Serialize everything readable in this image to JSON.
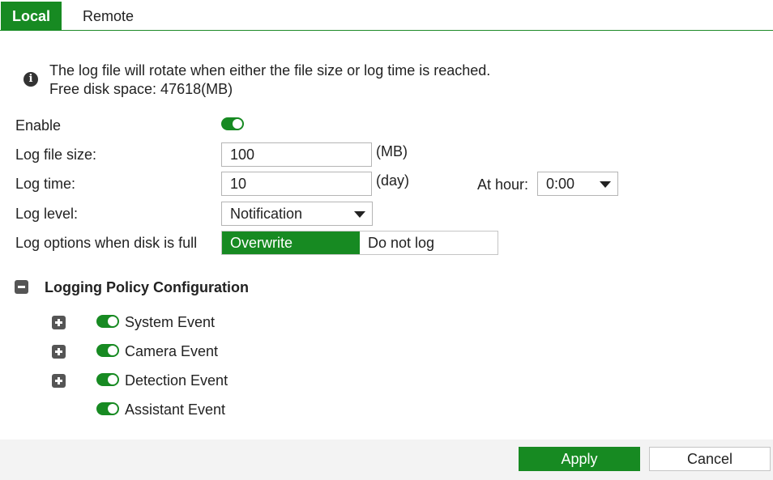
{
  "tabs": [
    {
      "label": "Local",
      "active": true
    },
    {
      "label": "Remote",
      "active": false
    }
  ],
  "info": {
    "icon": "info-icon",
    "line1": "The log file will rotate when either the file size or log time is reached.",
    "line2": "Free disk space: 47618(MB)"
  },
  "form": {
    "enable_label": "Enable",
    "enable_on": true,
    "log_file_size_label": "Log file size:",
    "log_file_size_value": "100",
    "log_file_size_unit": "(MB)",
    "log_time_label": "Log time:",
    "log_time_value": "10",
    "log_time_unit": "(day)",
    "at_hour_label": "At hour:",
    "at_hour_value": "0:00",
    "log_level_label": "Log level:",
    "log_level_value": "Notification",
    "disk_full_label": "Log options when disk is full",
    "disk_full_options": [
      "Overwrite",
      "Do not log"
    ],
    "disk_full_selected": "Overwrite"
  },
  "policy": {
    "title": "Logging Policy Configuration",
    "collapse_icon": "minus-square-icon",
    "events": [
      {
        "label": "System Event",
        "expandable": true,
        "enabled": true
      },
      {
        "label": "Camera Event",
        "expandable": true,
        "enabled": true
      },
      {
        "label": "Detection Event",
        "expandable": true,
        "enabled": true
      },
      {
        "label": "Assistant Event",
        "expandable": false,
        "enabled": true
      }
    ]
  },
  "footer": {
    "apply_label": "Apply",
    "cancel_label": "Cancel"
  },
  "colors": {
    "accent": "#178a22"
  }
}
